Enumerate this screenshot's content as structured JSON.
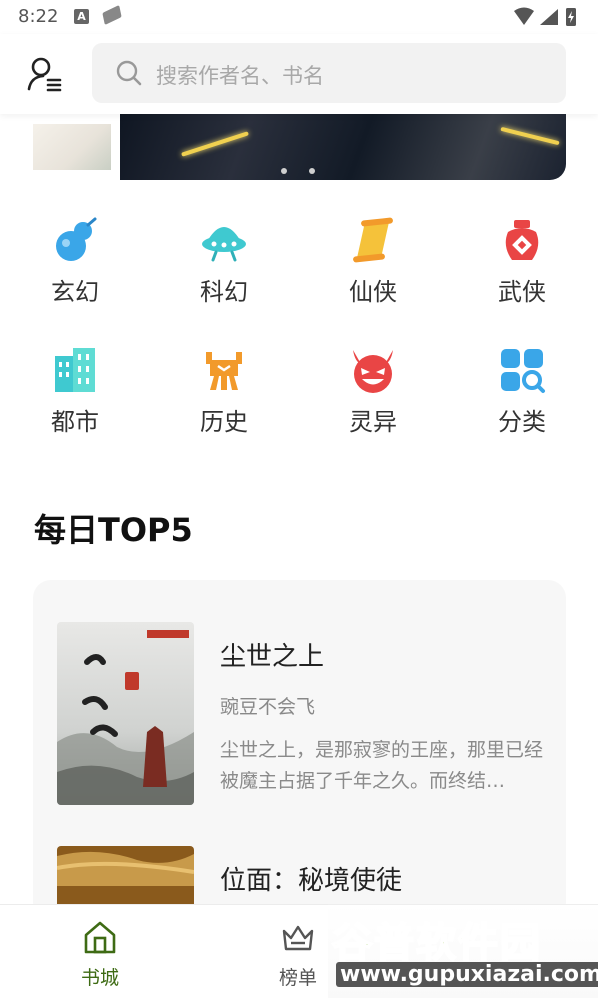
{
  "status": {
    "time": "8:22",
    "a_badge": "A"
  },
  "search": {
    "placeholder": "搜索作者名、书名"
  },
  "categories": [
    {
      "label": "玄幻",
      "icon": "gourd-icon"
    },
    {
      "label": "科幻",
      "icon": "ufo-icon"
    },
    {
      "label": "仙侠",
      "icon": "scroll-icon"
    },
    {
      "label": "武侠",
      "icon": "wine-jar-icon"
    },
    {
      "label": "都市",
      "icon": "building-icon"
    },
    {
      "label": "历史",
      "icon": "bronze-vessel-icon"
    },
    {
      "label": "灵异",
      "icon": "devil-icon"
    },
    {
      "label": "分类",
      "icon": "grid-search-icon"
    }
  ],
  "top5": {
    "title": "每日TOP5",
    "books": [
      {
        "title": "尘世之上",
        "author": "豌豆不会飞",
        "description": "尘世之上，是那寂寥的王座，那里已经被魔主占据了千年之久。而终结…"
      },
      {
        "title": "位面：秘境使徒",
        "author": "",
        "description": ""
      }
    ]
  },
  "nav": {
    "items": [
      {
        "label": "书城",
        "active": true
      },
      {
        "label": "榜单",
        "active": false
      }
    ]
  },
  "watermark": {
    "brand": "谷普软件园",
    "url": "www.gupuxiazai.com"
  },
  "colors": {
    "accent": "#3e6b14",
    "cyan": "#3fc9d0",
    "red": "#e94545",
    "orange": "#f29a2b"
  }
}
